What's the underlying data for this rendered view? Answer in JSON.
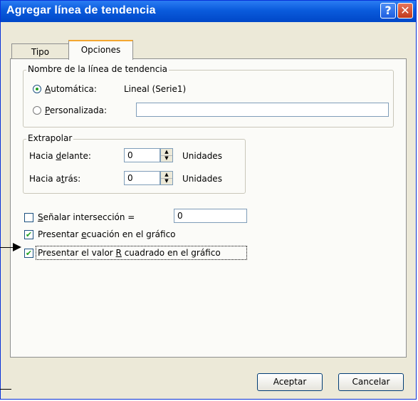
{
  "window": {
    "title": "Agregar línea de tendencia",
    "help_glyph": "?",
    "close_glyph": "✕"
  },
  "tabs": [
    {
      "label": "Tipo",
      "active": false
    },
    {
      "label": "Opciones",
      "active": true
    }
  ],
  "trendline_name": {
    "legend": "Nombre de la línea de tendencia",
    "automatic": {
      "label_u": "A",
      "label_rest": "utomática:",
      "value": "Lineal (Serie1)",
      "selected": true
    },
    "custom": {
      "label_u": "P",
      "label_rest": "ersonalizada:",
      "value": "",
      "selected": false
    }
  },
  "extrapolate": {
    "legend": "Extrapolar",
    "forward": {
      "label_pre": "Hacia ",
      "label_u": "d",
      "label_rest": "elante:",
      "value": "0",
      "unit": "Unidades"
    },
    "backward": {
      "label_pre": "Hacia a",
      "label_u": "t",
      "label_rest": "rás:",
      "value": "0",
      "unit": "Unidades"
    }
  },
  "options": {
    "intercept": {
      "label_u": "S",
      "label_rest": "eñalar intersección =",
      "checked": false,
      "value": "0"
    },
    "show_equation": {
      "label_pre": "Presentar ",
      "label_u": "e",
      "label_rest": "cuación en el gráfico",
      "checked": true
    },
    "show_r2": {
      "label_pre": "Presentar el valor ",
      "label_u": "R",
      "label_rest": " cuadrado en el gráfico",
      "checked": true
    }
  },
  "buttons": {
    "ok": "Aceptar",
    "cancel": "Cancelar"
  },
  "check_glyph": "✔",
  "spin_up_glyph": "▲",
  "spin_down_glyph": "▼"
}
